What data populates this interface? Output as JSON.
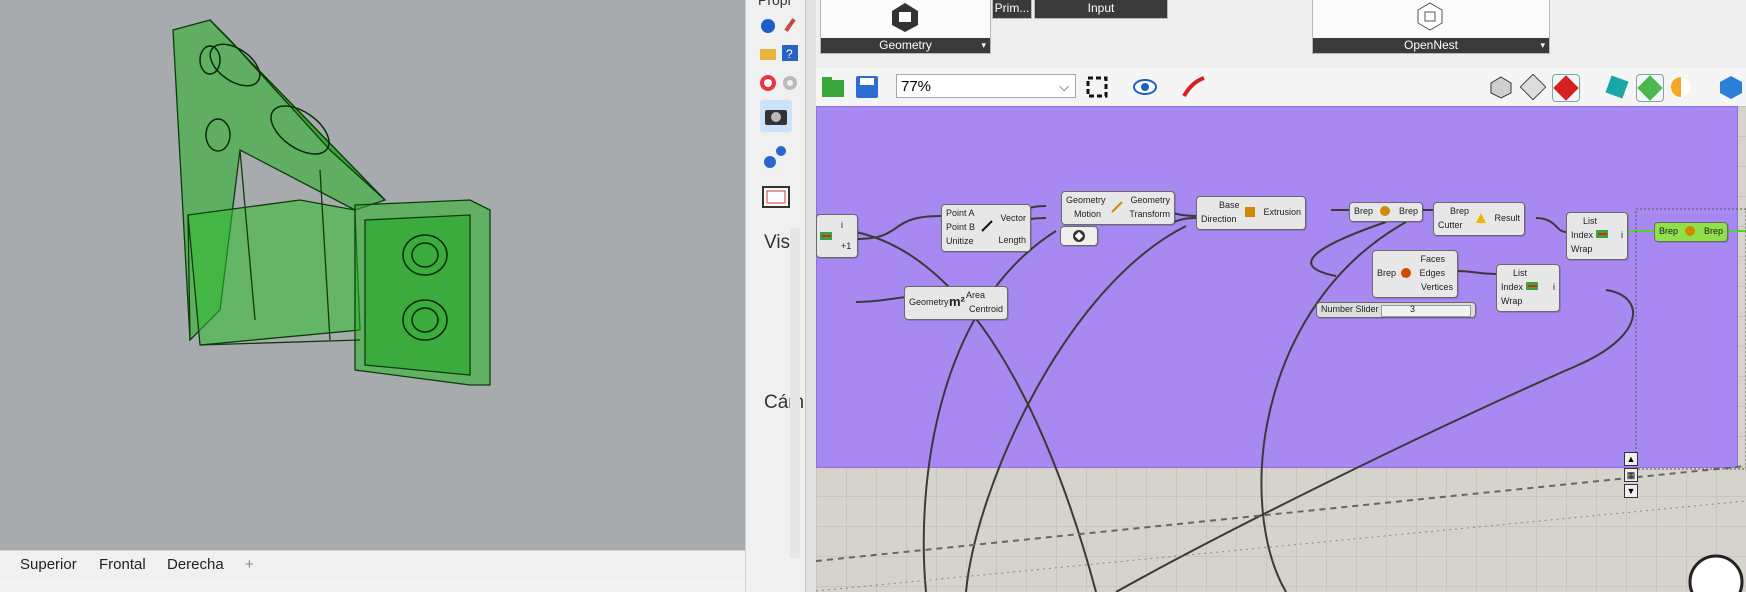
{
  "viewport": {
    "tabs": [
      "Superior",
      "Frontal",
      "Derecha"
    ],
    "add_tab": "+"
  },
  "properties": {
    "header": "Propi",
    "section_vis": "Vis",
    "section_cam": "Cám"
  },
  "ribbon": {
    "groups": [
      "Geometry",
      "Prim...",
      "Input",
      "OpenNest"
    ]
  },
  "toolbar": {
    "zoom": "77%"
  },
  "components": {
    "list_left": {
      "out": "i",
      "in": "+1"
    },
    "vector": {
      "in": [
        "Point A",
        "Point B",
        "Unitize"
      ],
      "out": [
        "Vector",
        "Length"
      ]
    },
    "move": {
      "in": [
        "Geometry",
        "Motion"
      ],
      "out": [
        "Geometry",
        "Transform"
      ]
    },
    "extrude": {
      "in": [
        "Base",
        "Direction"
      ],
      "out": "Extrusion"
    },
    "brep_param": {
      "in": "Brep",
      "out": "Brep"
    },
    "split": {
      "in": [
        "Brep",
        "Cutter"
      ],
      "out": "Result"
    },
    "list_item_1": {
      "in": [
        "List",
        "Index",
        "Wrap"
      ],
      "out": "i"
    },
    "brep_final": {
      "in": "Brep",
      "out": "Brep"
    },
    "area": {
      "in": "Geometry",
      "out": [
        "Area",
        "Centroid"
      ]
    },
    "deconstruct": {
      "in": "Brep",
      "out": [
        "Faces",
        "Edges",
        "Vertices"
      ]
    },
    "list_item_2": {
      "in": [
        "List",
        "Index",
        "Wrap"
      ],
      "out": "i"
    },
    "slider": {
      "label": "Number Slider",
      "value": "3"
    }
  },
  "colors": {
    "group": "#a889f2",
    "canvas": "#d6d3cc",
    "model": "#19b019",
    "final_param": "#8fe04a"
  }
}
